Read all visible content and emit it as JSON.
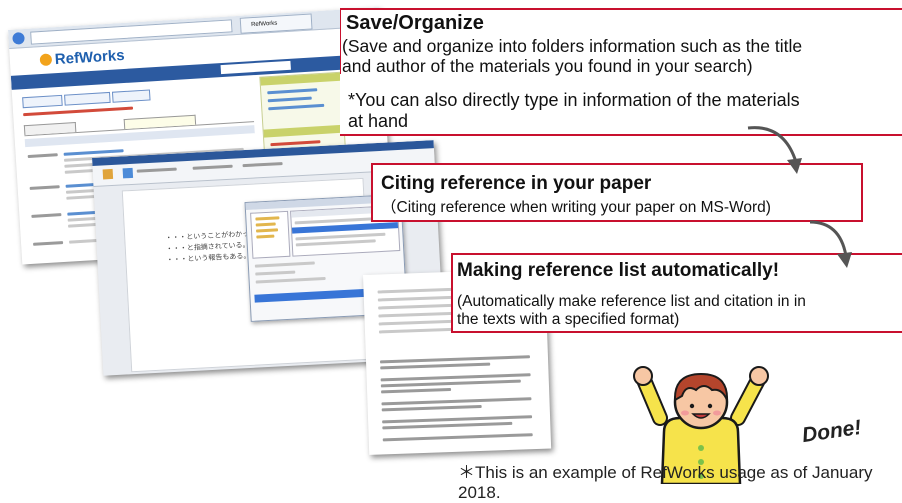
{
  "callouts": {
    "save": {
      "title": "Save/Organize",
      "body_lines": [
        "(Save and organize into folders information such as the title",
        "and author of the materials you found in your search)"
      ],
      "note_lines": [
        "*You can also directly type in information of the materials",
        "at hand"
      ]
    },
    "cite": {
      "title": "Citing reference in your paper",
      "body": "（Citing reference when writing your paper on MS-Word)"
    },
    "list": {
      "title": "Making reference list automatically!",
      "body_lines": [
        "(Automatically make reference list and citation in in",
        "the texts with a specified format)"
      ]
    }
  },
  "screenshots": {
    "refworks": {
      "logo_text": "RefWorks",
      "tab_label": "RefWorks"
    },
    "word": {
      "doc_lines": [
        "・・・ということがわかった(1)。",
        "・・・と指摘されている。・・・",
        "・・・という報告もある。"
      ]
    }
  },
  "mascot": {
    "exclamation": "Done!"
  },
  "footnote": "＊This is an example of RefWorks usage as of January 2018.",
  "colors": {
    "accent_red": "#c8102e",
    "arrow_gray": "#555555",
    "refworks_blue": "#1e5fae"
  }
}
